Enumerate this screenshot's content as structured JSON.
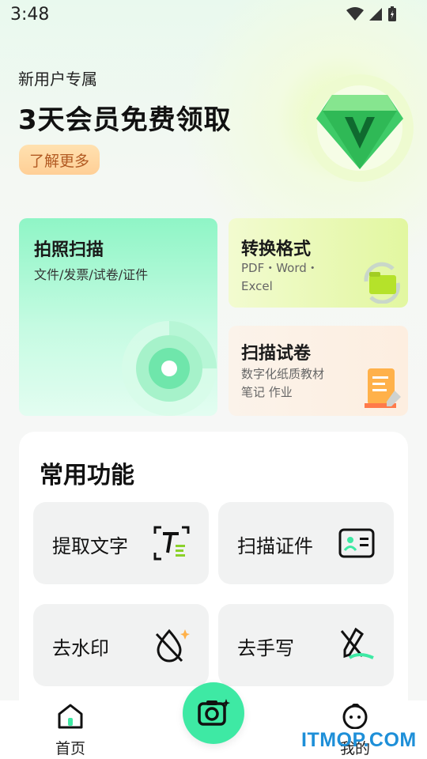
{
  "status_bar": {
    "time": "3:48"
  },
  "promo": {
    "subtitle": "新用户专属",
    "title": "3天会员免费领取",
    "button_label": "了解更多"
  },
  "cards": {
    "scan": {
      "title": "拍照扫描",
      "desc": "文件/发票/试卷/证件"
    },
    "convert": {
      "title": "转换格式",
      "desc_line1": "PDF・Word・",
      "desc_line2": "Excel"
    },
    "exam": {
      "title": "扫描试卷",
      "desc_line1": "数字化纸质教材",
      "desc_line2": "笔记 作业"
    }
  },
  "common_functions": {
    "title": "常用功能",
    "items": [
      {
        "label": "提取文字",
        "icon": "text-extract-icon"
      },
      {
        "label": "扫描证件",
        "icon": "id-card-icon"
      },
      {
        "label": "去水印",
        "icon": "remove-watermark-icon"
      },
      {
        "label": "去手写",
        "icon": "remove-handwriting-icon"
      }
    ]
  },
  "tab_bar": {
    "home_label": "首页",
    "mine_label": "我的"
  },
  "watermark_text": "ITMOP.COM",
  "colors": {
    "accent": "#3ee9a4",
    "scan_card": "#8ff5c6",
    "convert_card": "#e2f7a0",
    "exam_card": "#fdeee0",
    "promo_button": "#ffcf96"
  }
}
